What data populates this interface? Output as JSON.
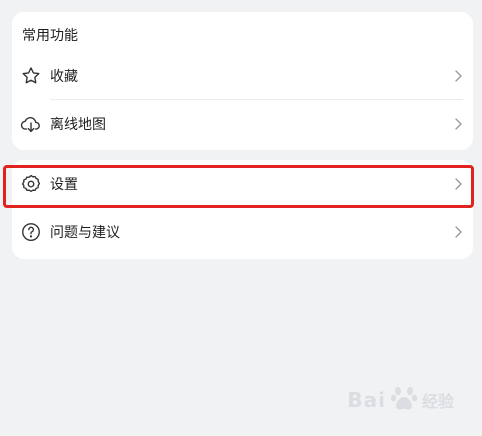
{
  "section": {
    "title": "常用功能"
  },
  "menu_top": [
    {
      "label": "收藏",
      "icon": "star-outline-icon"
    },
    {
      "label": "离线地图",
      "icon": "cloud-download-icon"
    }
  ],
  "menu_bottom": [
    {
      "label": "设置",
      "icon": "gear-icon",
      "highlighted": true
    },
    {
      "label": "问题与建议",
      "icon": "question-circle-icon"
    }
  ],
  "highlight_color": "#e0231e",
  "watermark": {
    "text_1": "Bai",
    "text_2": "经验"
  }
}
